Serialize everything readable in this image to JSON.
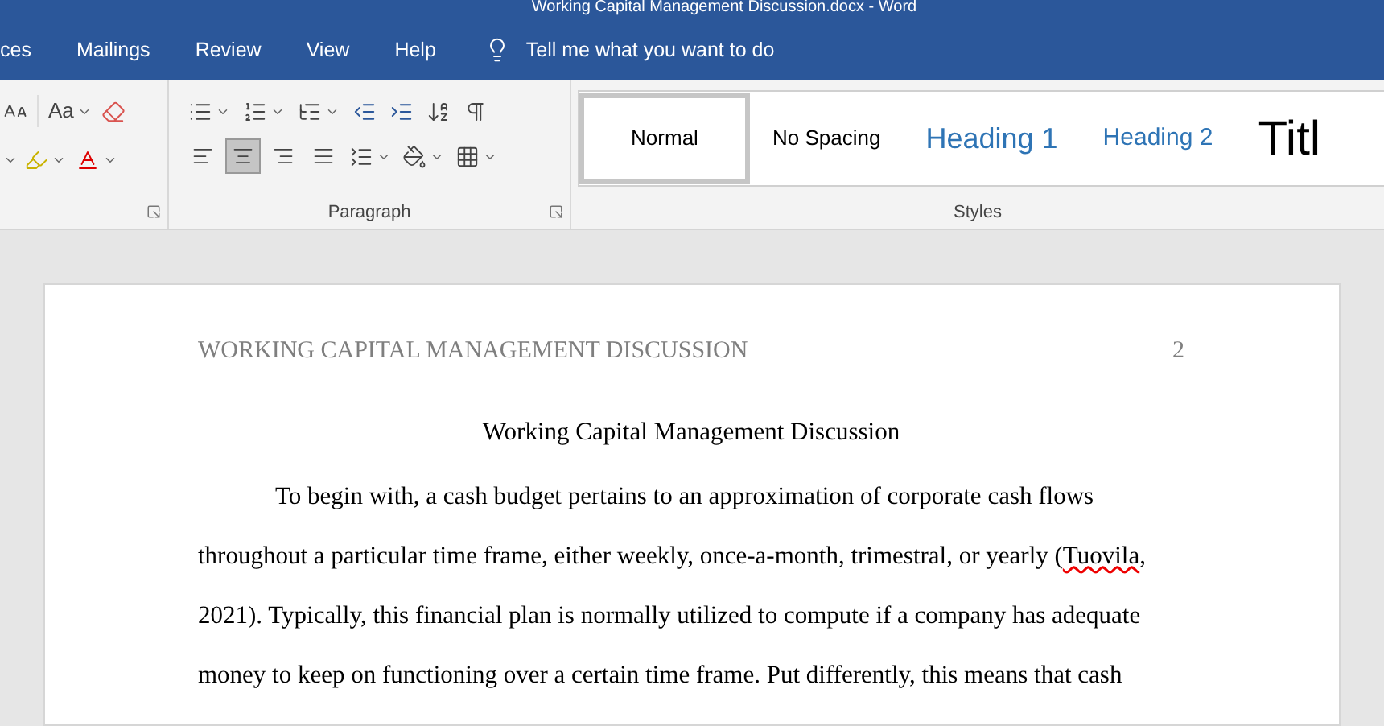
{
  "window": {
    "title": "Working Capital Management Discussion.docx  -  Word"
  },
  "tabs": [
    {
      "label": "ces",
      "selected": false
    },
    {
      "label": "Mailings",
      "selected": false
    },
    {
      "label": "Review",
      "selected": false
    },
    {
      "label": "View",
      "selected": false
    },
    {
      "label": "Help",
      "selected": false
    }
  ],
  "tell_me": {
    "placeholder": "Tell me what you want to do"
  },
  "font_group": {
    "case_label": "Aa"
  },
  "paragraph_group": {
    "label": "Paragraph",
    "alignment": [
      {
        "kind": "left",
        "selected": false
      },
      {
        "kind": "center",
        "selected": true
      },
      {
        "kind": "right",
        "selected": false
      },
      {
        "kind": "justify",
        "selected": false
      }
    ]
  },
  "styles_group": {
    "label": "Styles",
    "styles": [
      {
        "name": "Normal",
        "kind": "normal",
        "selected": true
      },
      {
        "name": "No Spacing",
        "kind": "normal",
        "selected": false
      },
      {
        "name": "Heading 1",
        "kind": "heading1",
        "selected": false
      },
      {
        "name": "Heading 2",
        "kind": "heading2",
        "selected": false
      },
      {
        "name": "Titl",
        "kind": "title",
        "selected": false
      }
    ]
  },
  "document": {
    "header": "WORKING CAPITAL MANAGEMENT DISCUSSION",
    "page_number": "2",
    "title": "Working Capital Management Discussion",
    "lines": [
      [
        {
          "text": "To begin with, a cash budget pertains to an approximation of corporate cash flows"
        }
      ],
      [
        {
          "text": "throughout a particular time frame, either weekly, once-a-month, trimestral, or yearly ("
        },
        {
          "text": "Tuovila",
          "misspelled": true
        },
        {
          "text": ","
        }
      ],
      [
        {
          "text": "2021). Typically, this financial plan is normally utilized to compute if a company has adequate"
        }
      ],
      [
        {
          "text": "money to keep on functioning over a certain time frame. Put differently, this means that cash"
        }
      ]
    ]
  }
}
